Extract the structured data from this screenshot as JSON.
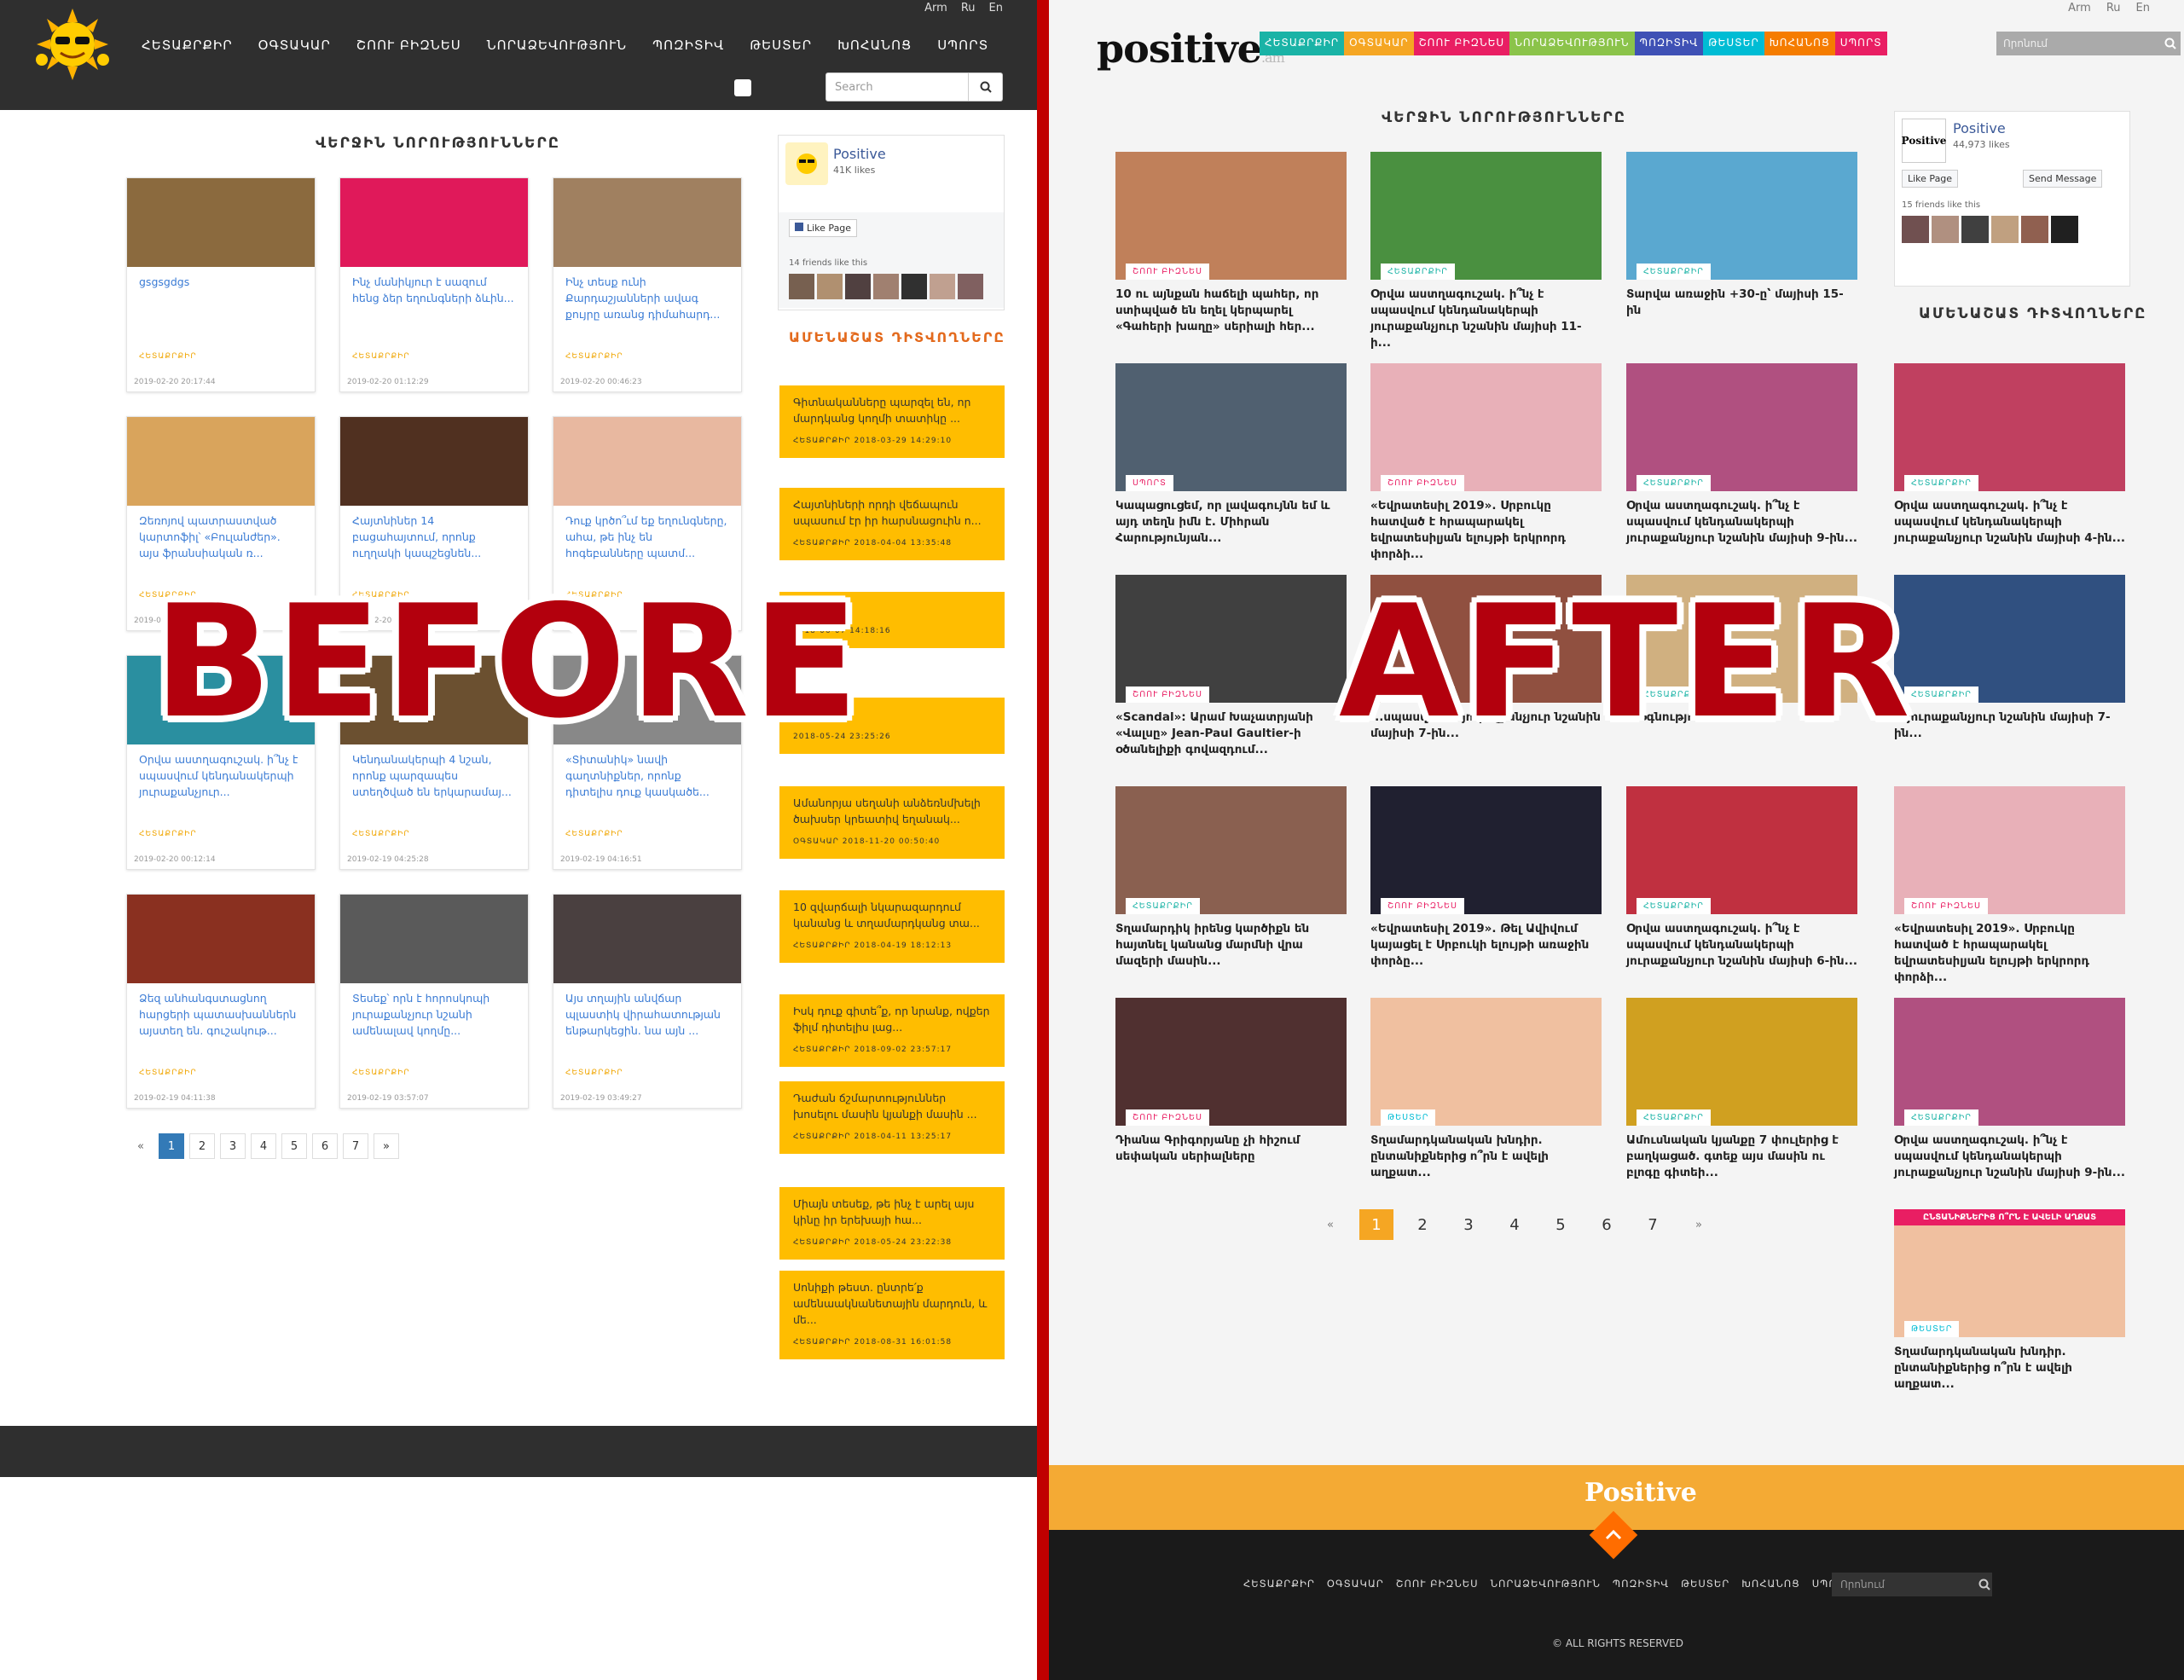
{
  "before_label": "BEFORE",
  "after_label": "AFTER",
  "left": {
    "lang": [
      "Arm",
      "Ru",
      "En"
    ],
    "nav": [
      "ՀԵՏԱՔՐՔԻՐ",
      "ՕԳՏԱԿԱՐ",
      "ՇՈՈՒ ԲԻԶՆԵՍ",
      "ՆՈՐԱՁԵՎՈՒԹՅՈՒՆ",
      "ՊՈԶԻՏԻՎ",
      "ԹԵՍՏԵՐ",
      "ԽՈՀԱՆՈՑ",
      "ՍՊՈՐՏ"
    ],
    "search_placeholder": "Search",
    "section_title": "ՎԵՐՋԻՆ ՆՈՐՈՒԹՅՈՒՆՆԵՐԸ",
    "cards": [
      {
        "title": "gsgsgdgs",
        "cat": "ՀԵՏԱՔՐՔԻՐ",
        "date": "2019-02-20 20:17:44",
        "color": "#8b6a3e"
      },
      {
        "title": "Ինչ մանիկյուր է սազում հենց ձեր եղունգների ձևին...",
        "cat": "ՀԵՏԱՔՐՔԻՐ",
        "date": "2019-02-20 01:12:29",
        "color": "#e0195a"
      },
      {
        "title": "Ինչ տեսք ունի Քարդաշյանների ավագ քույրը առանց դիմահարդ...",
        "cat": "ՀԵՏԱՔՐՔԻՐ",
        "date": "2019-02-20 00:46:23",
        "color": "#a08060"
      },
      {
        "title": "Զեռոյով պատրաստված կարտոֆիլ՝ «Բուլանժեր». այս ֆրանսիական ռ...",
        "cat": "ՀԵՏԱՔՐՔԻՐ",
        "date": "2019-02-20",
        "color": "#d9a45c"
      },
      {
        "title": "Հայտնիներ 14 բացահայտում, որոնք ուղղակի կապշեցնեն...",
        "cat": "ՀԵՏԱՔՐՔԻՐ",
        "date": "2019-02-20",
        "color": "#503020"
      },
      {
        "title": "Դուք կրծո՞ւմ եք եղունգները, ահա, թե ինչ են հոգեբանները պատմ...",
        "cat": "ՀԵՏԱՔՐՔԻՐ",
        "date": "2019-02-20",
        "color": "#e8b8a0"
      },
      {
        "title": "Օրվա աստղագուշակ. ի՞նչ է սպասվում կենդանակերպի յուրաքանչյուր...",
        "cat": "ՀԵՏԱՔՐՔԻՐ",
        "date": "2019-02-20 00:12:14",
        "color": "#2a8fa0"
      },
      {
        "title": "Կենդանակերպի 4 նշան, որոնք պարզապես ստեղծված են երկարամայ...",
        "cat": "ՀԵՏԱՔՐՔԻՐ",
        "date": "2019-02-19 04:25:28",
        "color": "#6b5030"
      },
      {
        "title": "«Տիտանիկ» նավի գաղտնիքներ, որոնք դիտելիս դուք կասկածե...",
        "cat": "ՀԵՏԱՔՐՔԻՐ",
        "date": "2019-02-19 04:16:51",
        "color": "#888"
      },
      {
        "title": "Ձեզ անհանգստացնող հարցերի պատասխաններն այստեղ են. գուշակութ...",
        "cat": "ՀԵՏԱՔՐՔԻՐ",
        "date": "2019-02-19 04:11:38",
        "color": "#8a3020"
      },
      {
        "title": "Տեսեք՝ որն է հորոսկոպի յուրաքանչյուր նշանի ամենալավ կողմը...",
        "cat": "ՀԵՏԱՔՐՔԻՐ",
        "date": "2019-02-19 03:57:07",
        "color": "#5a5a5a"
      },
      {
        "title": "Այս տղային անվճար պլաստիկ վիրահատության ենթարկեցին. նա այն ...",
        "cat": "ՀԵՏԱՔՐՔԻՐ",
        "date": "2019-02-19 03:49:27",
        "color": "#4a4040"
      }
    ],
    "pagination": [
      "«",
      "1",
      "2",
      "3",
      "4",
      "5",
      "6",
      "7",
      "»"
    ],
    "fb": {
      "name": "Positive",
      "likes": "41K likes",
      "like_btn": "Like Page",
      "friends": "14 friends like this"
    },
    "side_title": "ԱՄԵՆԱՇԱՏ ԴԻՏՎՈՂՆԵՐԸ",
    "popular": [
      {
        "title": "Գիտնականները պարզել են, որ մարդկանց կողմի տատիկը ...",
        "meta": "ՀԵՏԱՔՐՔԻՐ  2018-03-29 14:29:10"
      },
      {
        "title": "Հայտնիների որդի վեճապուն սպասում էր իր հարսնացուին ո...",
        "meta": "ՀԵՏԱՔՐՔԻՐ  2018-04-04 13:35:48"
      },
      {
        "title": "...",
        "meta": "2018-06-07 14:18:16"
      },
      {
        "title": "...",
        "meta": "2018-05-24 23:25:26"
      },
      {
        "title": "Ամանորյա սեղանի անձեռնմխելի ծախսեր կրեատիվ եղանակ...",
        "meta": "ՕԳՏԱԿԱՐ  2018-11-20 00:50:40"
      },
      {
        "title": "10 զվարճալի նկարազարդում կանանց և տղամարդկանց տա...",
        "meta": "ՀԵՏԱՔՐՔԻՐ  2018-04-19 18:12:13"
      },
      {
        "title": "Իսկ դուք գիտե՞ք, որ նրանք, ովքեր ֆիլմ դիտելիս լաց...",
        "meta": "ՀԵՏԱՔՐՔԻՐ  2018-09-02 23:57:17"
      },
      {
        "title": "Դաժան ճշմարտություններ խոսելու մասին կյանքի մասին ...",
        "meta": "ՀԵՏԱՔՐՔԻՐ  2018-04-11 13:25:17"
      },
      {
        "title": "Միայն տեսեք, թե ինչ է արել այս կինը իր երեխայի հա...",
        "meta": "ՀԵՏԱՔՐՔԻՐ  2018-05-24 23:22:38"
      },
      {
        "title": "Սոնիքի թեստ. ընտրե՛ք ամենաակնանետային մարդուն, և մե...",
        "meta": "ՀԵՏԱՔՐՔԻՐ  2018-08-31 16:01:58"
      }
    ]
  },
  "right": {
    "lang": [
      "Arm",
      "Ru",
      "En"
    ],
    "logo": "positive",
    "logo_suffix": ".am",
    "nav": [
      {
        "label": "ՀԵՏԱՔՐՔԻՐ",
        "color": "#1ab3a6"
      },
      {
        "label": "ՕԳՏԱԿԱՐ",
        "color": "#f5a623"
      },
      {
        "label": "ՇՈՈՒ ԲԻԶՆԵՍ",
        "color": "#e91e63"
      },
      {
        "label": "ՆՈՐԱՁԵՎՈՒԹՅՈՒՆ",
        "color": "#8bc34a"
      },
      {
        "label": "ՊՈԶԻՏԻՎ",
        "color": "#3f51b5"
      },
      {
        "label": "ԹԵՍՏԵՐ",
        "color": "#00bcd4"
      },
      {
        "label": "ԽՈՀԱՆՈՑ",
        "color": "#f57c00"
      },
      {
        "label": "ՍՊՈՐՏ",
        "color": "#e91e63"
      }
    ],
    "search_placeholder": "Որոնում",
    "section_title": "ՎԵՐՋԻՆ ՆՈՐՈՒԹՅՈՒՆՆԵՐԸ",
    "cards": [
      {
        "title": "10 ու այնքան հաճելի պահեր, որ ստիպված են եղել կերպարել «Գահերի խաղը» սերիալի հեր...",
        "tag": "ՇՈՈՒ ԲԻԶՆԵՍ",
        "tagc": "#e91e63",
        "color": "#c0805a"
      },
      {
        "title": "Օրվա աստղագուշակ. ի՞նչ է սպասվում կենդանակերպի յուրաքանչյուր նշանին մայիսի 11-ի...",
        "tag": "ՀԵՏԱՔՐՔԻՐ",
        "tagc": "#1ab3a6",
        "color": "#4a9040"
      },
      {
        "title": "Տարվա առաջին +30-ը՝ մայիսի 15-ին",
        "tag": "ՀԵՏԱՔՐՔԻՐ",
        "tagc": "#1ab3a6",
        "color": "#5aa8d0"
      },
      {
        "title": "Կապացուցեմ, որ լավագույնն եմ և այդ տեղն իմն է. Միհրան Հարությունյան...",
        "tag": "ՍՊՈՐՏ",
        "tagc": "#e91e63",
        "color": "#506070"
      },
      {
        "title": "«Եվրատեսիլ 2019». Սրբուկը հատված է հրապարակել եվրատեսիլյան ելույթի երկրորդ փորձի...",
        "tag": "ՇՈՈՒ ԲԻԶՆԵՍ",
        "tagc": "#e91e63",
        "color": "#e8b0b8"
      },
      {
        "title": "Օրվա աստղագուշակ. ի՞նչ է սպասվում կենդանակերպի յուրաքանչյուր նշանին մայիսի 9-ին...",
        "tag": "ՀԵՏԱՔՐՔԻՐ",
        "tagc": "#1ab3a6",
        "color": "#b05080"
      },
      {
        "title": "Օրվա աստղագուշակ. ի՞նչ է սպասվում կենդանակերպի յուրաքանչյուր նշանին մայիսի 4-ին...",
        "tag": "ՀԵՏԱՔՐՔԻՐ",
        "tagc": "#1ab3a6",
        "color": "#c04060"
      },
      {
        "title": "«Scandal»: Արամ Խաչատրյանի «Վալսը» Jean-Paul Gaultier-ի օծանելիքի գովազդում...",
        "tag": "ՇՈՈՒ ԲԻԶՆԵՍ",
        "tagc": "#e91e63",
        "color": "#404040"
      },
      {
        "title": "...սպասվում է յուրաքանչյուր նշանին մայիսի 7-ին...",
        "tag": "ՀԵՏԱՔՐՔԻՐ",
        "tagc": "#1ab3a6",
        "color": "#905040"
      },
      {
        "title": "...օգնություն...",
        "tag": "ՀԵՏԱՔՐՔԻՐ",
        "tagc": "#1ab3a6",
        "color": "#d0b080"
      },
      {
        "title": "...յուրաքանչյուր նշանին մայիսի 7-ին...",
        "tag": "ՀԵՏԱՔՐՔԻՐ",
        "tagc": "#1ab3a6",
        "color": "#305080"
      },
      {
        "title": "Տղամարդիկ իրենց կարծիքն են հայտնել կանանց մարմնի վրա մազերի մասին...",
        "tag": "ՀԵՏԱՔՐՔԻՐ",
        "tagc": "#1ab3a6",
        "color": "#8a6050"
      },
      {
        "title": "«Եվրատեսիլ 2019». Թել Ավիվում կայացել է Սրբուկի ելույթի առաջին փորձը...",
        "tag": "ՇՈՈՒ ԲԻԶՆԵՍ",
        "tagc": "#e91e63",
        "color": "#202030"
      },
      {
        "title": "Օրվա աստղագուշակ. ի՞նչ է սպասվում կենդանակերպի յուրաքանչյուր նշանին մայիսի 6-ին...",
        "tag": "ՀԵՏԱՔՐՔԻՐ",
        "tagc": "#1ab3a6",
        "color": "#c03040"
      },
      {
        "title": "«Եվրատեսիլ 2019». Սրբուկը հատված է հրապարակել եվրատեսիլյան ելույթի երկրորդ փորձի...",
        "tag": "ՇՈՈՒ ԲԻԶՆԵՍ",
        "tagc": "#e91e63",
        "color": "#e8b0b8"
      },
      {
        "title": "Դիանա Գրիգորյանը չի հիշում սեփական սերիալները",
        "tag": "ՇՈՈՒ ԲԻԶՆԵՍ",
        "tagc": "#e91e63",
        "color": "#503030"
      },
      {
        "title": "Տղամարդկանական խնդիր. ընտանիքներից ո՞րն է ավելի աղքատ...",
        "tag": "ԹԵՍՏԵՐ",
        "tagc": "#00bcd4",
        "color": "#f0c0a0"
      },
      {
        "title": "Ամուսնական կյանքը 7 փուլերից է բաղկացած. գտեք այս մասին ու բլոգը գիտեի...",
        "tag": "ՀԵՏԱՔՐՔԻՐ",
        "tagc": "#1ab3a6",
        "color": "#d0a020"
      },
      {
        "title": "Օրվա աստղագուշակ. ի՞նչ է սպասվում կենդանակերպի յուրաքանչյուր նշանին մայիսի 9-ին...",
        "tag": "ՀԵՏԱՔՐՔԻՐ",
        "tagc": "#1ab3a6",
        "color": "#b05080"
      }
    ],
    "side_card": {
      "title": "Տղամարդկանական խնդիր. ընտանիքներից ո՞րն է ավելի աղքատ...",
      "tag": "ԹԵՍՏԵՐ",
      "banner": "ԸՆՏԱՆԻՔՆԵՐԻՑ Ո՞ՐՆ Է ԱՎԵԼԻ ԱՂՔԱՏ"
    },
    "pagination": [
      "«",
      "1",
      "2",
      "3",
      "4",
      "5",
      "6",
      "7",
      "»"
    ],
    "fb": {
      "name": "Positive",
      "likes": "44,973 likes",
      "like_btn": "Like Page",
      "send_btn": "Send Message",
      "friends": "15 friends like this"
    },
    "side_title": "ԱՄԵՆԱՇԱՏ ԴԻՏՎՈՂՆԵՐԸ",
    "footer": {
      "logo": "Positive",
      "nav": [
        "ՀԵՏԱՔՐՔԻՐ",
        "ՕԳՏԱԿԱՐ",
        "ՇՈՈՒ ԲԻԶՆԵՍ",
        "ՆՈՐԱՁԵՎՈՒԹՅՈՒՆ",
        "ՊՈԶԻՏԻՎ",
        "ԹԵՍՏԵՐ",
        "ԽՈՀԱՆՈՑ",
        "ՍՊՈՐՏ"
      ],
      "search_placeholder": "Որոնում",
      "copyright": "© ALL RIGHTS RESERVED"
    }
  }
}
